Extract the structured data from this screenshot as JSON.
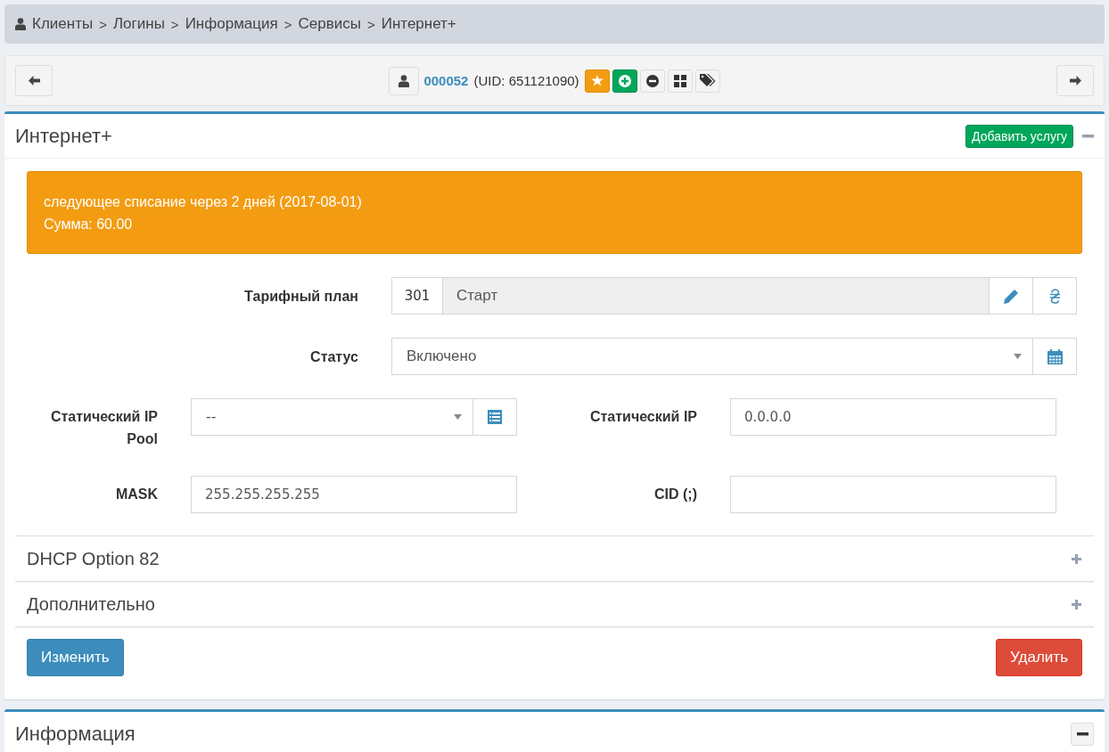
{
  "breadcrumb": {
    "separator": ">",
    "items": [
      "Клиенты",
      "Логины",
      "Информация",
      "Сервисы",
      "Интернет+"
    ]
  },
  "user_bar": {
    "login": "000052",
    "uid": "(UID: 651121090)"
  },
  "service_panel": {
    "title": "Интернет+",
    "add_button": "Добавить услугу",
    "expanded": true,
    "alert": {
      "lines": [
        "следующее списание через 2 дней (2017-08-01)",
        "Сумма: 60.00"
      ]
    },
    "tariff": {
      "label": "Тарифный план",
      "code": "301",
      "name": "Старт"
    },
    "status": {
      "label": "Статус",
      "value": "Включено"
    },
    "fields": [
      {
        "label": "Статический IP Pool",
        "kind": "select",
        "value": "--"
      },
      {
        "label": "Статический IP",
        "kind": "text",
        "value": "0.0.0.0"
      },
      {
        "label": "MASK",
        "kind": "text",
        "value": "255.255.255.255"
      },
      {
        "label": "CID (;)",
        "kind": "text"
      }
    ],
    "sections": [
      {
        "title": "DHCP Option 82",
        "expanded": false
      },
      {
        "title": "Дополнительно",
        "expanded": false
      }
    ],
    "buttons": {
      "save": "Изменить",
      "delete": "Удалить"
    }
  },
  "info_panel": {
    "title": "Информация",
    "expanded": true
  }
}
